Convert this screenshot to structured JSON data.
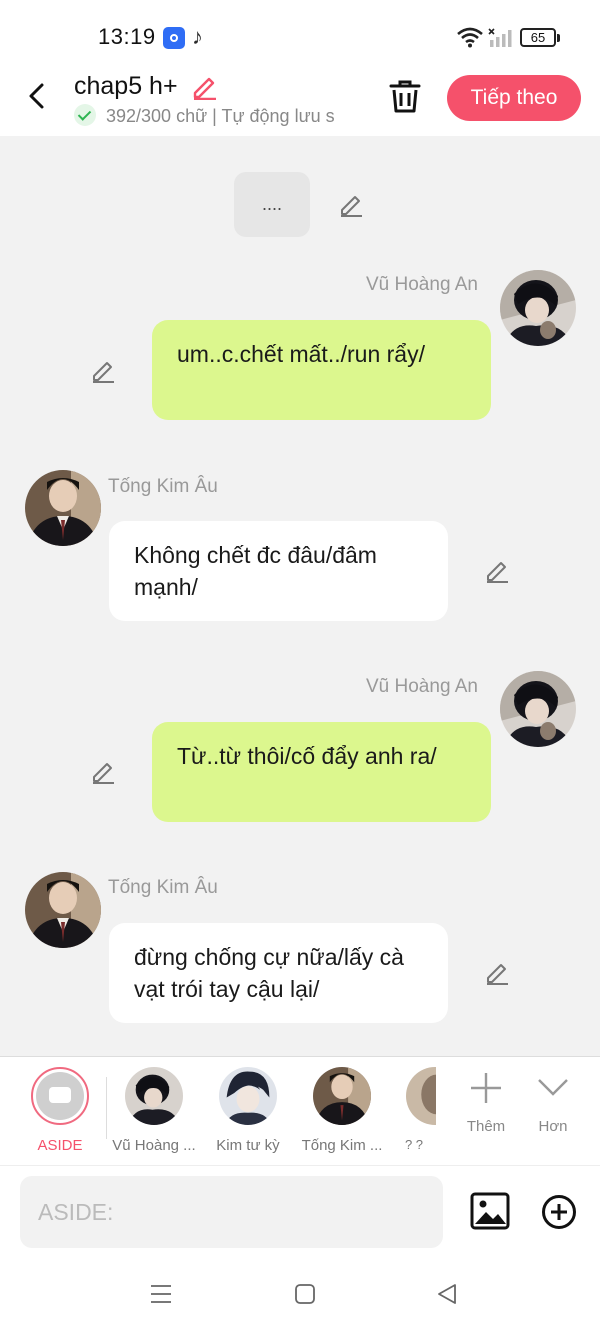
{
  "status_bar": {
    "time": "13:19",
    "battery": "65"
  },
  "header": {
    "title": "chap5 h+",
    "status_text": "392/300 chữ | Tự động lưu s",
    "next_button": "Tiếp theo"
  },
  "chat": {
    "narration": "....",
    "messages": [
      {
        "speaker": "Vũ Hoàng An",
        "text": "um..c.chết mất../run rẩy/"
      },
      {
        "speaker": "Tống Kim Âu",
        "text": "Không chết đc đâu/đâm mạnh/"
      },
      {
        "speaker": "Vũ Hoàng An",
        "text": "Từ..từ thôi/cố đẩy anh ra/"
      },
      {
        "speaker": "Tống Kim Âu",
        "text": "đừng chống cự nữa/lấy cà vạt trói tay cậu lại/"
      }
    ]
  },
  "character_bar": {
    "items": [
      {
        "label": "ASIDE"
      },
      {
        "label": "Vũ Hoàng ..."
      },
      {
        "label": "Kim tư kỳ"
      },
      {
        "label": "Tống Kim ..."
      },
      {
        "label": "? ?"
      }
    ],
    "more_label": "Thêm",
    "collapse_label": "Hơn"
  },
  "input": {
    "placeholder": "ASIDE:"
  },
  "colors": {
    "accent": "#f5516b",
    "own_bubble": "#dcf78e",
    "other_bubble": "#ffffff",
    "background": "#f2f2f2"
  }
}
